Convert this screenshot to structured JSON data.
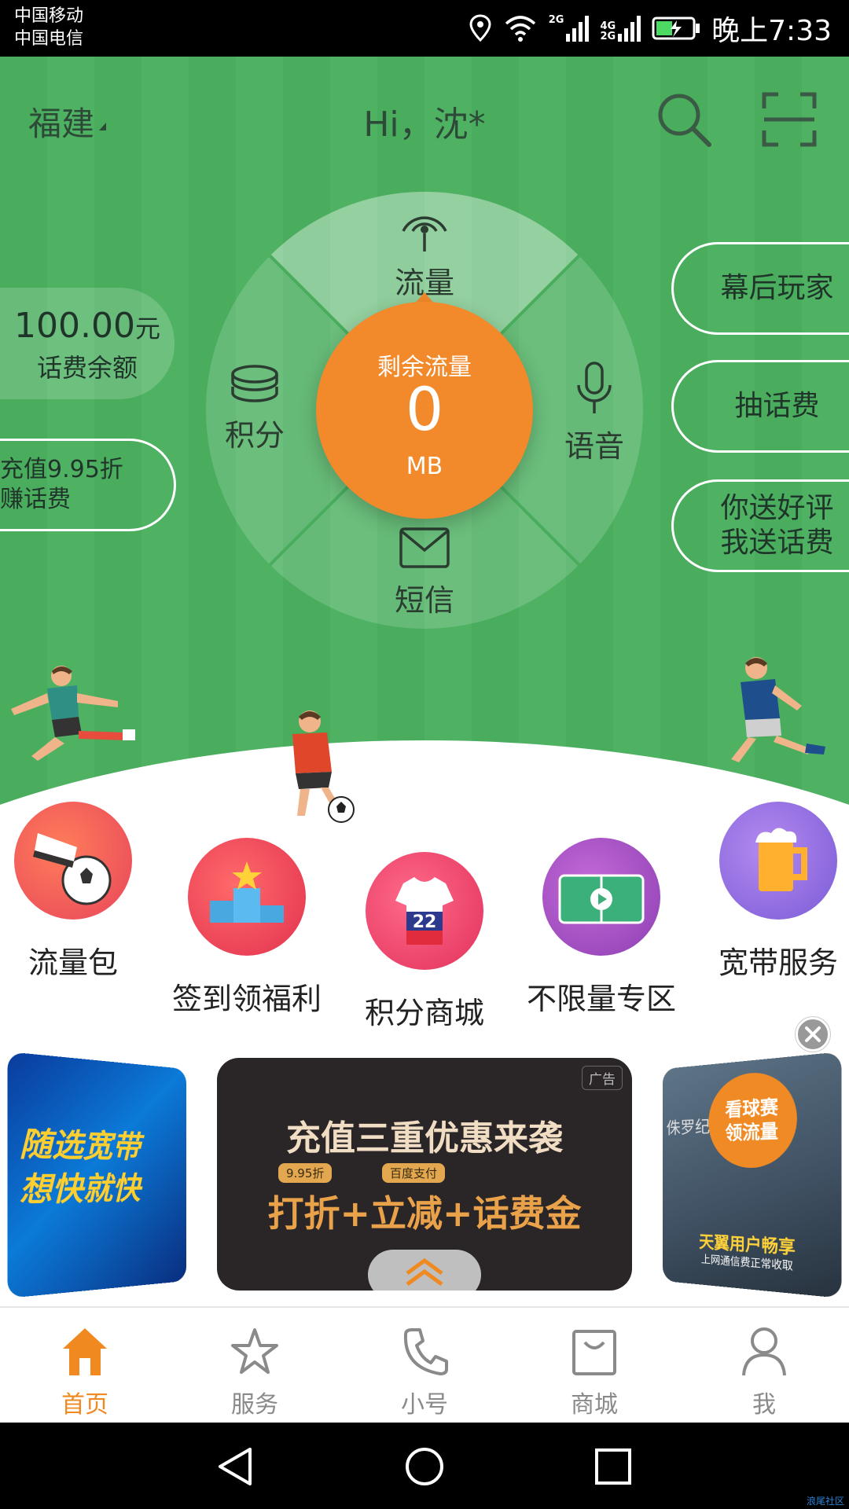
{
  "status_bar": {
    "carrier_1": "中国移动",
    "carrier_2": "中国电信",
    "net_1": "2G",
    "net_2a": "4G",
    "net_2b": "2G",
    "time": "晚上7:33"
  },
  "header": {
    "region": "福建",
    "greeting": "Hi，沈*"
  },
  "dial": {
    "top_label": "流量",
    "left_label": "积分",
    "right_label": "语音",
    "bottom_label": "短信",
    "center_title": "剩余流量",
    "center_value": "0",
    "center_unit": "MB"
  },
  "left_cards": {
    "balance_amount": "100.00",
    "balance_unit": "元",
    "balance_label": "话费余额",
    "promo_line1": "充值9.95折",
    "promo_line2": "赚话费"
  },
  "right_cards": [
    {
      "lines": [
        "幕后玩家"
      ]
    },
    {
      "lines": [
        "抽话费"
      ]
    },
    {
      "lines": [
        "你送好评",
        "我送话费"
      ]
    }
  ],
  "quick_menu": [
    {
      "label": "流量包"
    },
    {
      "label": "签到领福利"
    },
    {
      "label": "积分商城"
    },
    {
      "label": "不限量专区"
    },
    {
      "label": "宽带服务"
    }
  ],
  "banners": {
    "main": {
      "ad_tag": "广告",
      "title": "充值三重优惠来袭",
      "tag1": "9.95折",
      "tag2": "百度支付",
      "subtitle": "打折+立减+话费金"
    },
    "left_line1": "随选宽带",
    "left_line2": "想快就快",
    "right_badge_1": "看球赛",
    "right_badge_2": "领流量",
    "right_side_text": "侏罗纪",
    "right_bottom_1": "天翼用户畅享",
    "right_bottom_2": "上网通信费正常收取"
  },
  "tabs": [
    {
      "label": "首页",
      "icon": "home-icon",
      "active": true
    },
    {
      "label": "服务",
      "icon": "star-icon",
      "active": false
    },
    {
      "label": "小号",
      "icon": "phone-icon",
      "active": false
    },
    {
      "label": "商城",
      "icon": "shopping-bag-icon",
      "active": false
    },
    {
      "label": "我",
      "icon": "user-icon",
      "active": false
    }
  ],
  "watermark": "浪尾社区",
  "colors": {
    "hero_green": "#4caf60",
    "accent_orange": "#f2892a",
    "tab_active": "#f0891f",
    "tab_inactive": "#8a8a8a"
  }
}
